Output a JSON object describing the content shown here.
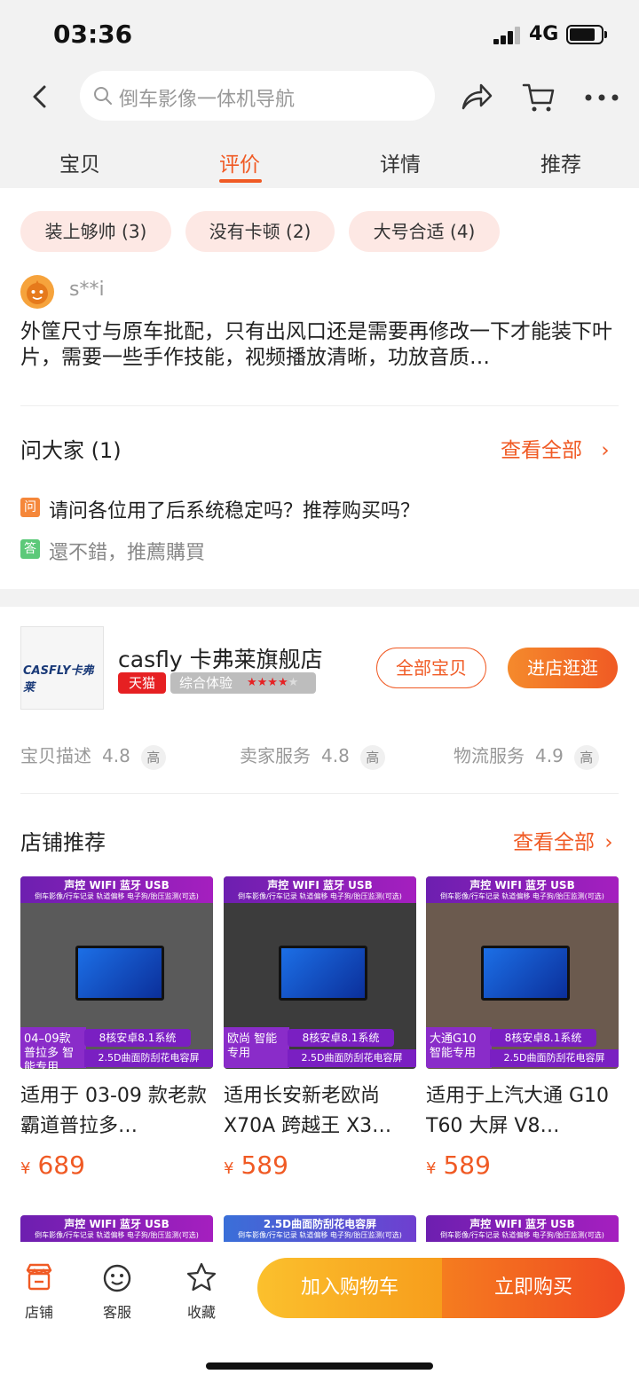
{
  "status": {
    "time": "03:36",
    "network": "4G"
  },
  "search": {
    "placeholder": "倒车影像一体机导航"
  },
  "tabs": [
    {
      "label": "宝贝"
    },
    {
      "label": "评价"
    },
    {
      "label": "详情"
    },
    {
      "label": "推荐"
    }
  ],
  "active_tab": "评价",
  "review": {
    "tags": [
      {
        "label": "装上够帅 (3)"
      },
      {
        "label": "没有卡顿 (2)"
      },
      {
        "label": "大号合适 (4)"
      }
    ],
    "username": "s**i",
    "text": "外筐尺寸与原车批配，只有出风口还是需要再修改一下才能装下叶片，需要一些手作技能，视频播放清晰，功放音质…"
  },
  "ask": {
    "title": "问大家 (1)",
    "see_all": "查看全部",
    "question_badge": "问",
    "question": "请问各位用了后系统稳定吗？推荐购买吗？",
    "answer_badge": "答",
    "answer": "還不錯，推薦購買"
  },
  "store": {
    "logo_text": "CASFLY卡弗莱",
    "name": "casfly 卡弗莱旗舰店",
    "badge": "天猫",
    "experience": "综合体验",
    "stars": "★★★★★",
    "all_items_btn": "全部宝贝",
    "enter_btn": "进店逛逛",
    "metrics": [
      {
        "label": "宝贝描述",
        "value": "4.8",
        "level": "高"
      },
      {
        "label": "卖家服务",
        "value": "4.8",
        "level": "高"
      },
      {
        "label": "物流服务",
        "value": "4.9",
        "level": "高"
      }
    ],
    "rec_title": "店铺推荐",
    "rec_see_all": "查看全部"
  },
  "products": [
    {
      "banner_top": "声控 WIFI 蓝牙 USB",
      "banner_sub": "倒车影像/行车记录 轨道偏移 电子狗/胎压监测(可选)",
      "side_tag": "04–09款 普拉多 智能专用",
      "tag1": "8核安卓8.1系统",
      "tag2": "2.5D曲面防刮花电容屏",
      "title": "适用于 03-09 款老款霸道普拉多…",
      "currency": "¥",
      "price": "689"
    },
    {
      "banner_top": "声控 WIFI 蓝牙 USB",
      "banner_sub": "倒车影像/行车记录 轨道偏移 电子狗/胎压监测(可选)",
      "side_tag": "欧尚 智能专用",
      "tag1": "8核安卓8.1系统",
      "tag2": "2.5D曲面防刮花电容屏",
      "title": "适用长安新老欧尚 X70A 跨越王 X3…",
      "currency": "¥",
      "price": "589"
    },
    {
      "banner_top": "声控 WIFI 蓝牙 USB",
      "banner_sub": "倒车影像/行车记录 轨道偏移 电子狗/胎压监测(可选)",
      "side_tag": "大通G10 智能专用",
      "tag1": "8核安卓8.1系统",
      "tag2": "2.5D曲面防刮花电容屏",
      "title": "适用于上汽大通 G10 T60 大屏 V8…",
      "currency": "¥",
      "price": "589"
    }
  ],
  "products_next": [
    {
      "banner_top": "声控 WIFI 蓝牙 USB",
      "banner_sub": "倒车影像/行车记录 轨道偏移 电子狗/胎压监测(可选)"
    },
    {
      "banner_top": "2.5D曲面防刮花电容屏",
      "banner_sub": "倒车影像/行车记录 轨道偏移 电子狗/胎压监测(可选)"
    },
    {
      "banner_top": "声控 WIFI 蓝牙 USB",
      "banner_sub": "倒车影像/行车记录 轨道偏移 电子狗/胎压监测(可选)"
    }
  ],
  "bottom": {
    "shop": "店铺",
    "service": "客服",
    "favorite": "收藏",
    "add_cart": "加入购物车",
    "buy_now": "立即购买"
  },
  "colors": {
    "accent": "#f05a24",
    "tmall": "#e62022",
    "pill_bg": "#fde8e4"
  }
}
